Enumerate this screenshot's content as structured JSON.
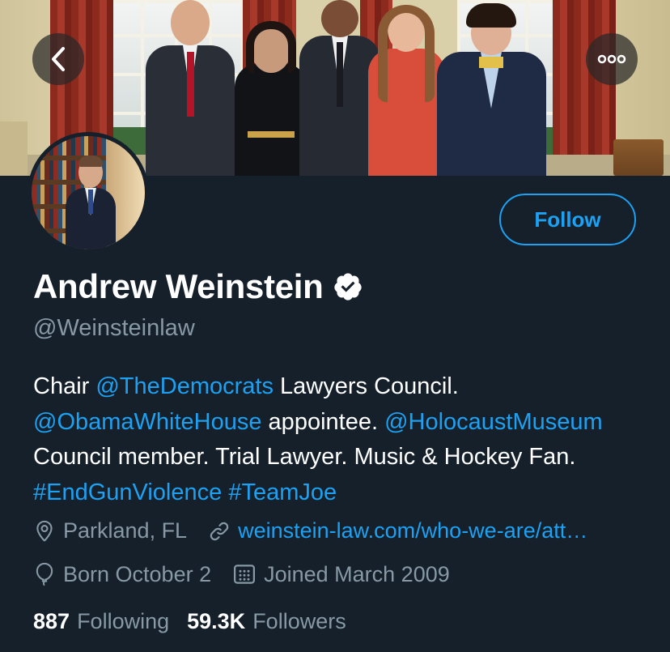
{
  "profile": {
    "name": "Andrew Weinstein",
    "handle": "@Weinsteinlaw",
    "verified": true,
    "follow_label": "Follow",
    "bio": [
      {
        "text": "Chair ",
        "link": false
      },
      {
        "text": "@TheDemocrats",
        "link": true
      },
      {
        "text": " Lawyers Council. ",
        "link": false
      },
      {
        "text": "@ObamaWhiteHouse",
        "link": true
      },
      {
        "text": " appointee. ",
        "link": false
      },
      {
        "text": "@HolocaustMuseum",
        "link": true
      },
      {
        "text": " Council member. Trial Lawyer. Music & Hockey Fan. ",
        "link": false
      },
      {
        "text": "#EndGunViolence",
        "link": true
      },
      {
        "text": " ",
        "link": false
      },
      {
        "text": "#TeamJoe",
        "link": true
      }
    ],
    "location": "Parkland, FL",
    "website": "weinstein-law.com/who-we-are/att…",
    "birthday": "Born October 2",
    "joined": "Joined March 2009",
    "following_count": "887",
    "following_label": "Following",
    "followers_count": "59.3K",
    "followers_label": "Followers"
  },
  "icons": {
    "back": "chevron-left-icon",
    "more": "more-dots-icon",
    "verified": "verified-badge-icon",
    "location": "location-pin-icon",
    "link": "link-icon",
    "birthday": "balloon-icon",
    "joined": "calendar-icon"
  },
  "colors": {
    "background": "#15202b",
    "accent": "#1da1f2",
    "secondary_text": "#8899a6",
    "primary_text": "#ffffff"
  }
}
